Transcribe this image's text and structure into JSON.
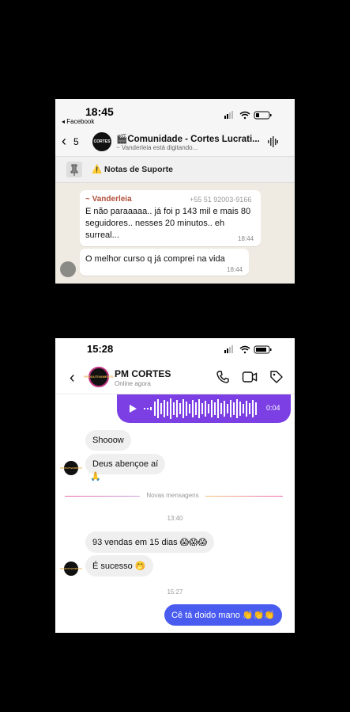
{
  "whatsapp": {
    "status_time": "18:45",
    "back_app": "◂ Facebook",
    "back_count": "5",
    "group_avatar_text": "CORTES",
    "group_title": "🎬Comunidade - Cortes Lucrati...",
    "group_subtitle": "~ Vanderleia está digitando...",
    "pinned_label": "⚠️ Notas de Suporte",
    "messages": [
      {
        "sender": "~ Vanderleia",
        "phone": "+55 51 92003-9166",
        "text": "E não paraaaaa.. já foi p 143 mil e mais 80 seguidores.. nesses 20 minutos.. eh surreal...",
        "time": "18:44"
      },
      {
        "text": "O melhor curso q já comprei na vida",
        "time": "18:44"
      }
    ]
  },
  "instagram": {
    "status_time": "15:28",
    "contact_name": "PM CORTES",
    "contact_status": "Online agora",
    "avatar_text": "PRODUTIVAMENTE",
    "audio_duration": "0:04",
    "messages_top": [
      {
        "text": "Shooow"
      },
      {
        "text": "Deus abençoe aí"
      },
      {
        "text": "🙏"
      }
    ],
    "new_messages_label": "Novas mensagens",
    "time_1": "13:40",
    "messages_mid": [
      {
        "text": "93 vendas em 15 dias 😱😱😱"
      },
      {
        "text": "É sucesso 🤭"
      }
    ],
    "time_2": "15:27",
    "sent_message": "Cê tá doido mano 👏👏👏"
  }
}
